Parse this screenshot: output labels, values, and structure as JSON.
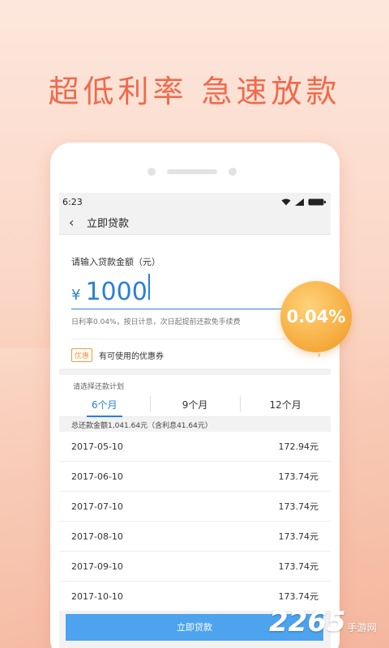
{
  "headline": "超低利率  急速放款",
  "status_bar": {
    "time": "6:23",
    "icons": [
      "wifi-icon",
      "signal-icon",
      "battery-icon"
    ]
  },
  "nav": {
    "back_icon": "chevron-left-icon",
    "title": "立即贷款"
  },
  "loan": {
    "prompt": "请输入贷款金额（元）",
    "currency": "¥",
    "amount": "1000",
    "hint": "日利率0.04%，按日计息，次日起提前还款免手续费"
  },
  "coupon": {
    "badge": "优惠",
    "text": "有可使用的优惠券",
    "icon": "chevron-right-icon"
  },
  "plan": {
    "title": "请选择还款计划",
    "tabs": [
      {
        "label": "6个月",
        "active": true
      },
      {
        "label": "9个月",
        "active": false
      },
      {
        "label": "12个月",
        "active": false
      }
    ],
    "total": "总还款金额1,041.64元（含利息41.64元）",
    "rows": [
      {
        "date": "2017-05-10",
        "amount": "172.94元"
      },
      {
        "date": "2017-06-10",
        "amount": "173.74元"
      },
      {
        "date": "2017-07-10",
        "amount": "173.74元"
      },
      {
        "date": "2017-08-10",
        "amount": "173.74元"
      },
      {
        "date": "2017-09-10",
        "amount": "173.74元"
      },
      {
        "date": "2017-10-10",
        "amount": "173.74元"
      }
    ]
  },
  "cta_label": "立即贷款",
  "rate_badge": "0.04%",
  "watermark": {
    "number": "2265",
    "text": "手游网"
  },
  "colors": {
    "accent": "#2a7fd9",
    "headline": "#f06a4c",
    "badge": "#f5a93a",
    "button": "#4da3ee"
  }
}
